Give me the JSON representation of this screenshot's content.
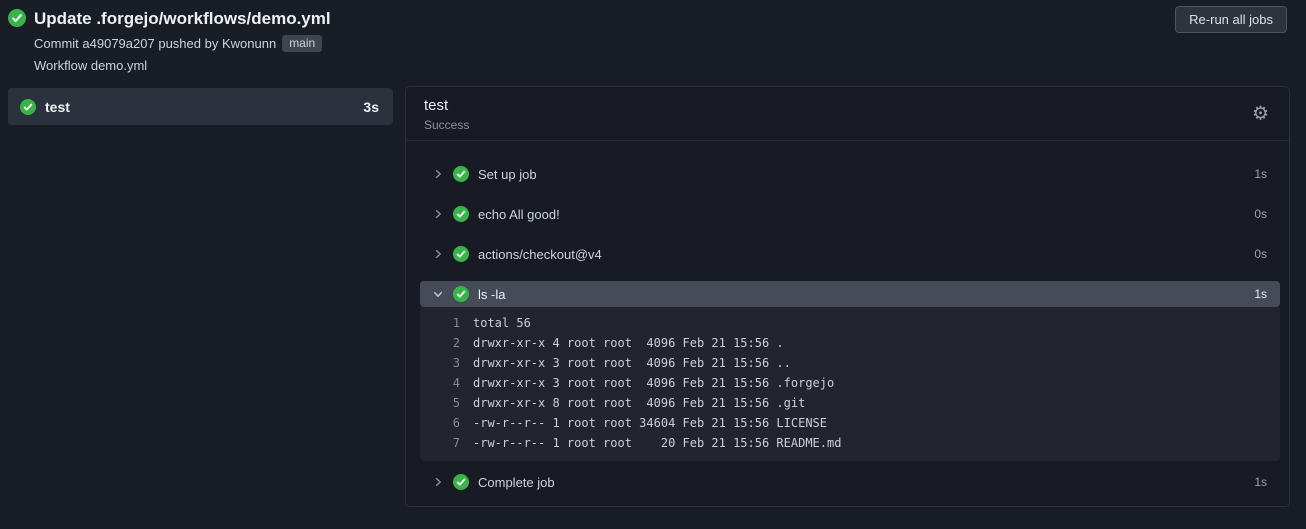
{
  "header": {
    "title": "Update .forgejo/workflows/demo.yml",
    "commit": {
      "label": "Commit",
      "sha": "a49079a207",
      "middle": "pushed by",
      "author": "Kwonunn",
      "branch": "main"
    },
    "workflow": {
      "label": "Workflow",
      "name": "demo.yml"
    },
    "rerun_button_label": "Re-run all jobs"
  },
  "sidebar": {
    "jobs": [
      {
        "name": "test",
        "duration": "3s",
        "status": "success",
        "selected": true
      }
    ]
  },
  "job_panel": {
    "title": "test",
    "status": "Success",
    "steps": [
      {
        "label": "Set up job",
        "duration": "1s",
        "status": "success",
        "expanded": false
      },
      {
        "label": "echo All good!",
        "duration": "0s",
        "status": "success",
        "expanded": false
      },
      {
        "label": "actions/checkout@v4",
        "duration": "0s",
        "status": "success",
        "expanded": false
      },
      {
        "label": "ls -la",
        "duration": "1s",
        "status": "success",
        "expanded": true,
        "logs": [
          {
            "num": "1",
            "text": "total 56"
          },
          {
            "num": "2",
            "text": "drwxr-xr-x 4 root root  4096 Feb 21 15:56 ."
          },
          {
            "num": "3",
            "text": "drwxr-xr-x 3 root root  4096 Feb 21 15:56 .."
          },
          {
            "num": "4",
            "text": "drwxr-xr-x 3 root root  4096 Feb 21 15:56 .forgejo"
          },
          {
            "num": "5",
            "text": "drwxr-xr-x 8 root root  4096 Feb 21 15:56 .git"
          },
          {
            "num": "6",
            "text": "-rw-r--r-- 1 root root 34604 Feb 21 15:56 LICENSE"
          },
          {
            "num": "7",
            "text": "-rw-r--r-- 1 root root    20 Feb 21 15:56 README.md"
          }
        ]
      },
      {
        "label": "Complete job",
        "duration": "1s",
        "status": "success",
        "expanded": false
      }
    ]
  },
  "icons": {
    "status_success": "check-circle-icon",
    "settings_glyph": "⚙",
    "collapsed": "chevron-right-icon",
    "expanded": "chevron-down-icon"
  },
  "colors": {
    "success_green": "#3ab44a",
    "page_bg": "#191d25",
    "panel_bg": "#181b23",
    "panel_border": "#2c313c",
    "expanded_row_bg": "#454b57",
    "selected_job_bg": "#2b323e",
    "log_bg": "#22252e"
  }
}
